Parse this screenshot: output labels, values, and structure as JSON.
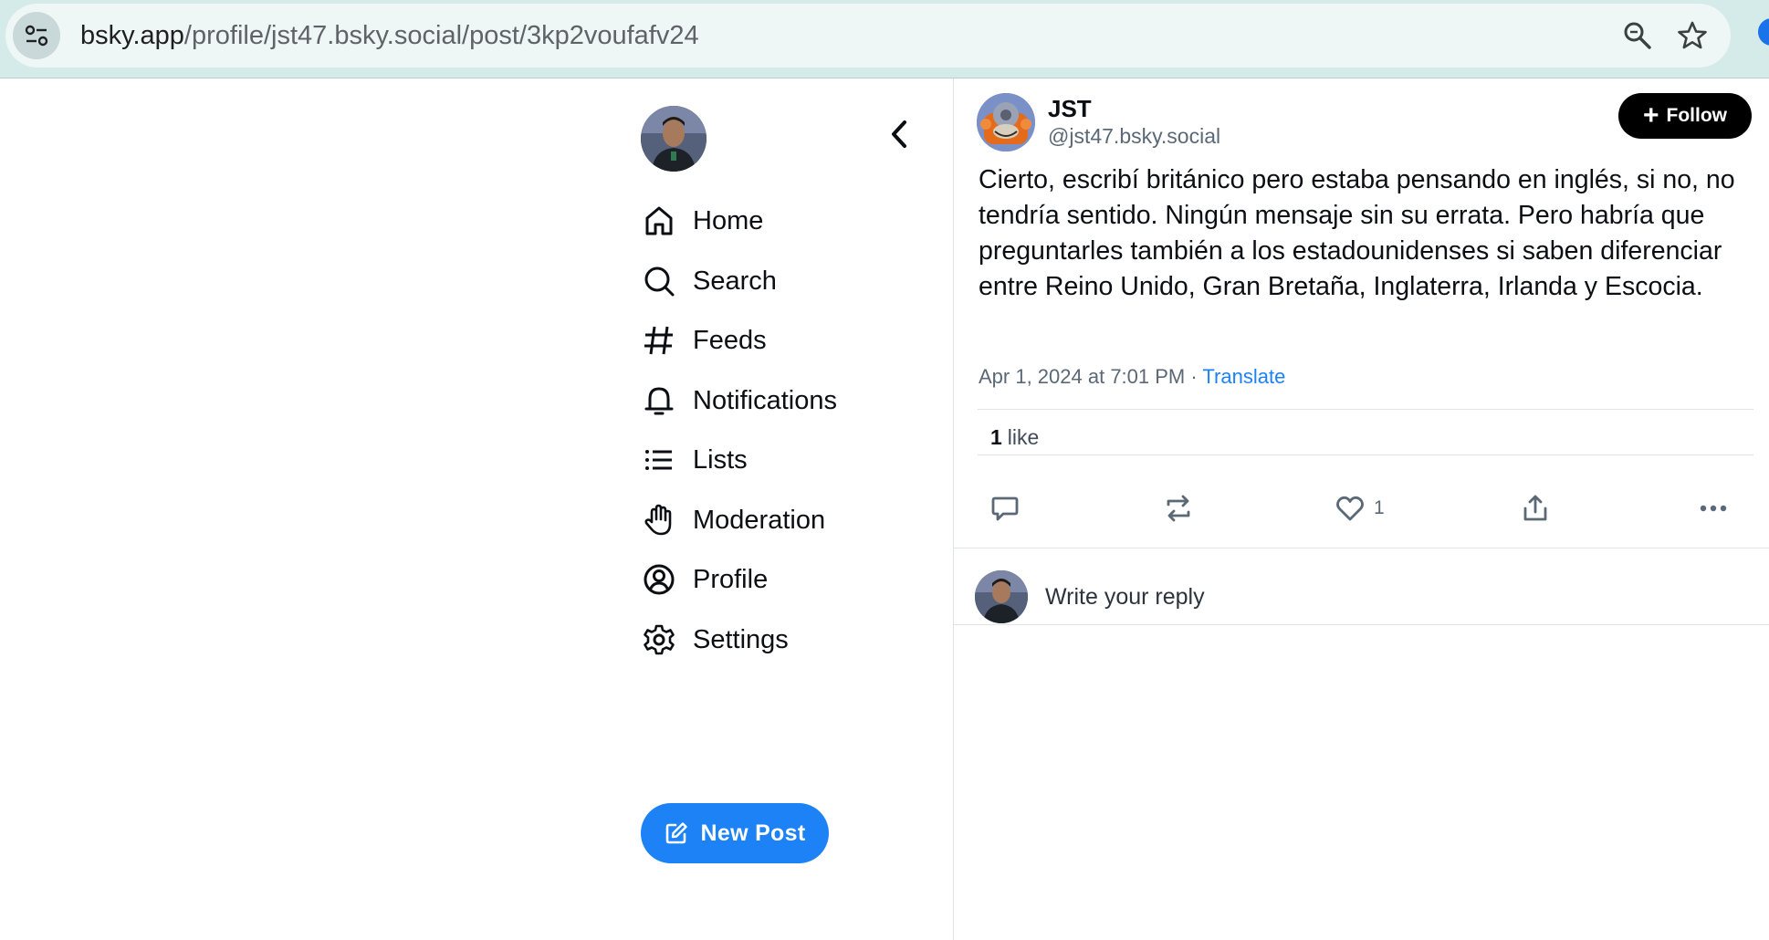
{
  "browser": {
    "url_host": "bsky.app",
    "url_path": "/profile/jst47.bsky.social/post/3kp2voufafv24",
    "icons": [
      "site-settings-icon",
      "zoom-icon",
      "bookmark-star-icon"
    ]
  },
  "nav": {
    "items": [
      {
        "label": "Home",
        "icon": "home-icon"
      },
      {
        "label": "Search",
        "icon": "search-icon"
      },
      {
        "label": "Feeds",
        "icon": "hashtag-icon"
      },
      {
        "label": "Notifications",
        "icon": "bell-icon"
      },
      {
        "label": "Lists",
        "icon": "list-icon"
      },
      {
        "label": "Moderation",
        "icon": "hand-icon"
      },
      {
        "label": "Profile",
        "icon": "user-circle-icon"
      },
      {
        "label": "Settings",
        "icon": "gear-icon"
      }
    ],
    "new_post_label": "New Post"
  },
  "post": {
    "author_name": "JST",
    "author_handle": "@jst47.bsky.social",
    "follow_label": "Follow",
    "text": "Cierto, escribí británico pero estaba pensando en inglés, si no, no tendría sentido. Ningún mensaje sin su errata. Pero habría que preguntarles también a los estadounidenses si saben diferenciar entre Reino Unido, Gran Bretaña, Inglaterra, Irlanda y Escocia.",
    "timestamp": "Apr 1, 2024 at 7:01 PM",
    "separator": " · ",
    "translate_label": "Translate",
    "like_count": "1",
    "like_word": "like",
    "action_like_count": "1"
  },
  "reply": {
    "placeholder": "Write your reply"
  },
  "colors": {
    "accent": "#1d82f5",
    "browser_bar": "#d5ebea",
    "follow_bg": "#000000"
  }
}
